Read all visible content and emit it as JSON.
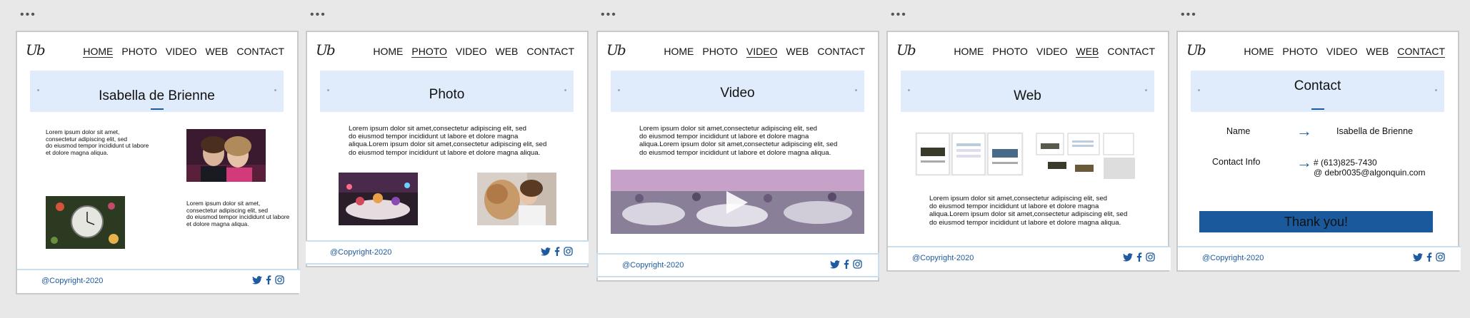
{
  "board_menu": "•••",
  "logo": "Ub",
  "nav": {
    "home": "HOME",
    "photo": "PHOTO",
    "video": "VIDEO",
    "web": "WEB",
    "contact": "CONTACT"
  },
  "pages": {
    "home": {
      "title": "Isabella de Brienne",
      "para1": "Lorem ipsum dolor sit amet,\n consectetur adipiscing elit, sed\ndo eiusmod tempor incididunt ut labore\net dolore magna aliqua.",
      "para2": "Lorem ipsum dolor sit amet,\nconsectetur adipiscing elit, sed\ndo eiusmod tempor incididunt ut labore\net dolore magna aliqua."
    },
    "photo": {
      "title": "Photo",
      "para": "Lorem ipsum dolor sit amet,consectetur adipiscing elit, sed\ndo eiusmod tempor incididunt ut labore et dolore magna\naliqua.Lorem ipsum dolor sit amet,consectetur adipiscing elit, sed\ndo eiusmod tempor incididunt ut labore et dolore magna aliqua."
    },
    "video": {
      "title": "Video",
      "para": "Lorem ipsum dolor sit amet,consectetur adipiscing elit, sed\ndo eiusmod tempor incididunt ut labore et dolore magna\naliqua.Lorem ipsum dolor sit amet,consectetur adipiscing elit, sed\ndo eiusmod tempor incididunt ut labore et dolore magna aliqua."
    },
    "web": {
      "title": "Web",
      "para": "Lorem ipsum dolor sit amet,consectetur adipiscing elit, sed\ndo eiusmod tempor incididunt ut labore et dolore magna\naliqua.Lorem ipsum dolor sit amet,consectetur adipiscing elit, sed\ndo eiusmod tempor incididunt ut labore et dolore magna aliqua."
    },
    "contact": {
      "title": "Contact",
      "name_label": "Name",
      "name_value": "Isabella de Brienne",
      "info_label": "Contact Info",
      "phone": "# (613)825-7430",
      "email": "@ debr0035@algonquin.com",
      "button": "Thank you!"
    }
  },
  "footer": {
    "copyright": "@Copyright-2020"
  },
  "colors": {
    "accent": "#1e5aa0",
    "banner": "#e0ecfb",
    "button": "#1a5a9c"
  },
  "icons": [
    "twitter-icon",
    "facebook-icon",
    "instagram-icon",
    "arrow-right-icon",
    "play-icon"
  ]
}
